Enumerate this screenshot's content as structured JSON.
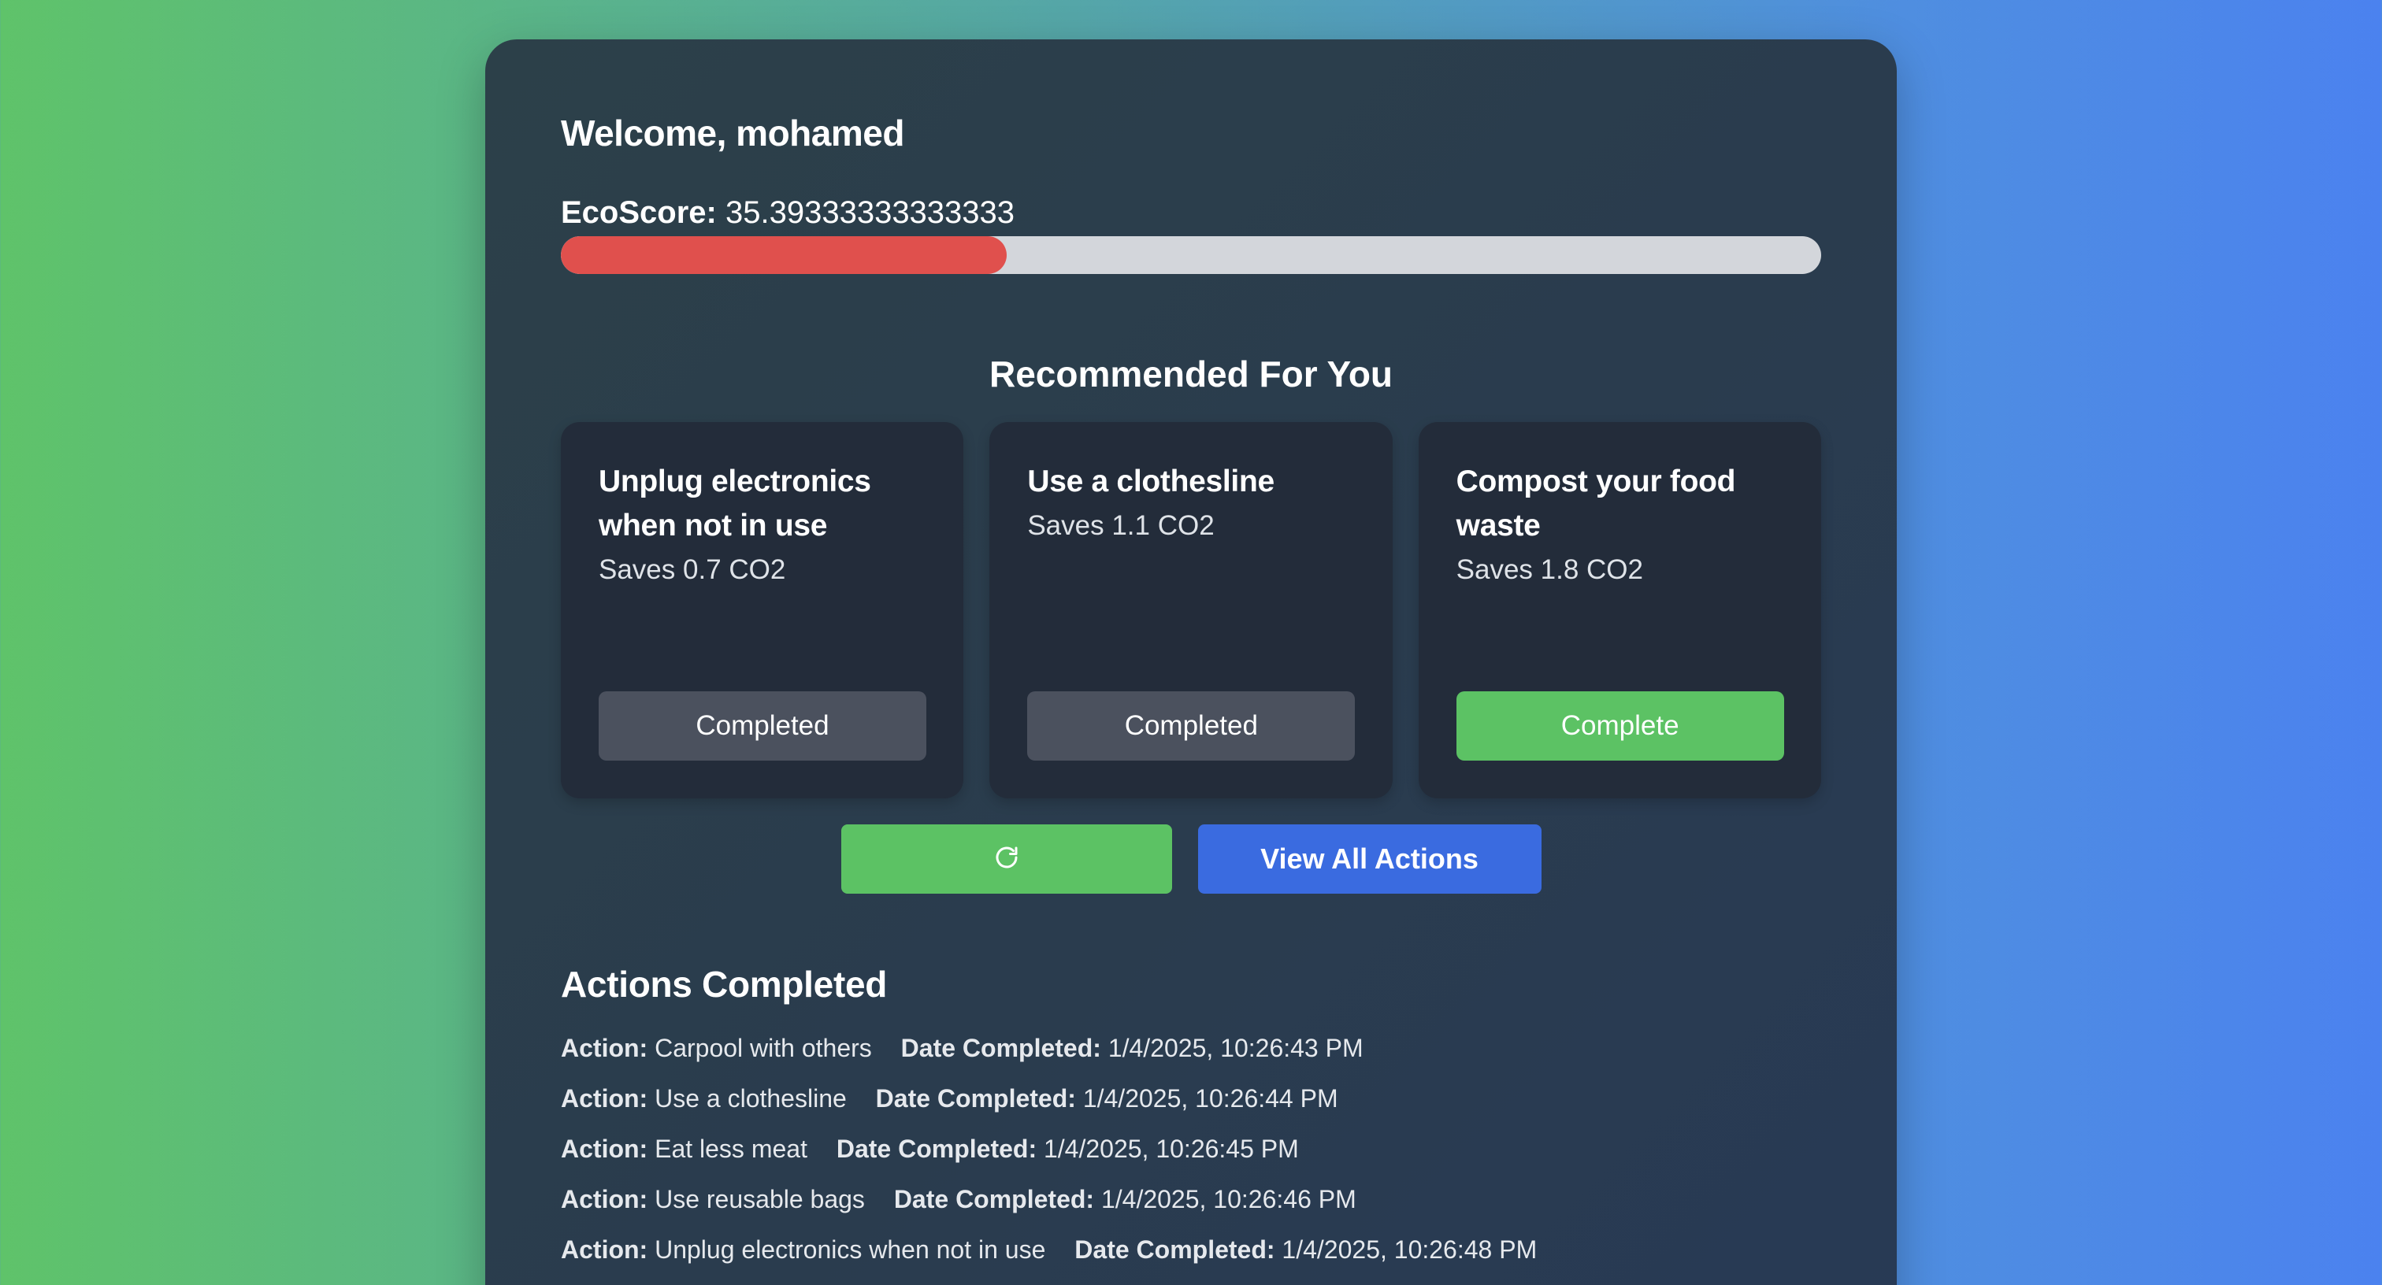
{
  "user": {
    "welcome": "Welcome, mohamed"
  },
  "ecoscore": {
    "label": "EcoScore:",
    "value": "35.39333333333333",
    "progress_percent": 35.39,
    "fill_color": "#e0504d"
  },
  "recommended": {
    "title": "Recommended For You",
    "cards": [
      {
        "title": "Unplug electronics when not in use",
        "saves": "Saves 0.7 CO2",
        "button": "Completed",
        "state": "completed"
      },
      {
        "title": "Use a clothesline",
        "saves": "Saves 1.1 CO2",
        "button": "Completed",
        "state": "completed"
      },
      {
        "title": "Compost your food waste",
        "saves": "Saves 1.8 CO2",
        "button": "Complete",
        "state": "pending"
      }
    ]
  },
  "controls": {
    "refresh_icon": "refresh-icon",
    "view_all": "View All Actions"
  },
  "history": {
    "title": "Actions Completed",
    "action_label": "Action:",
    "date_label": "Date Completed:",
    "items": [
      {
        "action": "Carpool with others",
        "date": "1/4/2025, 10:26:43 PM"
      },
      {
        "action": "Use a clothesline",
        "date": "1/4/2025, 10:26:44 PM"
      },
      {
        "action": "Eat less meat",
        "date": "1/4/2025, 10:26:45 PM"
      },
      {
        "action": "Use reusable bags",
        "date": "1/4/2025, 10:26:46 PM"
      },
      {
        "action": "Unplug electronics when not in use",
        "date": "1/4/2025, 10:26:48 PM"
      }
    ]
  },
  "colors": {
    "completed_button": "#4b515e",
    "complete_button": "#5cc264",
    "view_all_button": "#3a6be0"
  }
}
